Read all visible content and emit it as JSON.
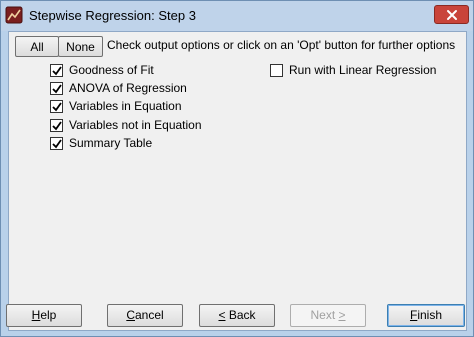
{
  "window": {
    "title": "Stepwise Regression: Step 3"
  },
  "toolbar": {
    "all_label": "All",
    "none_label": "None",
    "instructions": "Check output options or click on an 'Opt' button for further options"
  },
  "options": [
    {
      "label": "Goodness of Fit",
      "checked": true
    },
    {
      "label": "ANOVA of Regression",
      "checked": true
    },
    {
      "label": "Variables in Equation",
      "checked": true
    },
    {
      "label": "Variables not in Equation",
      "checked": true
    },
    {
      "label": "Summary Table",
      "checked": true
    }
  ],
  "extra_option": {
    "label": "Run with Linear Regression",
    "checked": false
  },
  "footer": {
    "help": {
      "before": "",
      "key": "H",
      "after": "elp"
    },
    "cancel": {
      "before": "",
      "key": "C",
      "after": "ancel"
    },
    "back": {
      "before": "",
      "key": "<",
      "after": " Back"
    },
    "next": {
      "before": "Next ",
      "key": ">",
      "after": ""
    },
    "finish": {
      "before": "",
      "key": "F",
      "after": "inish"
    }
  }
}
